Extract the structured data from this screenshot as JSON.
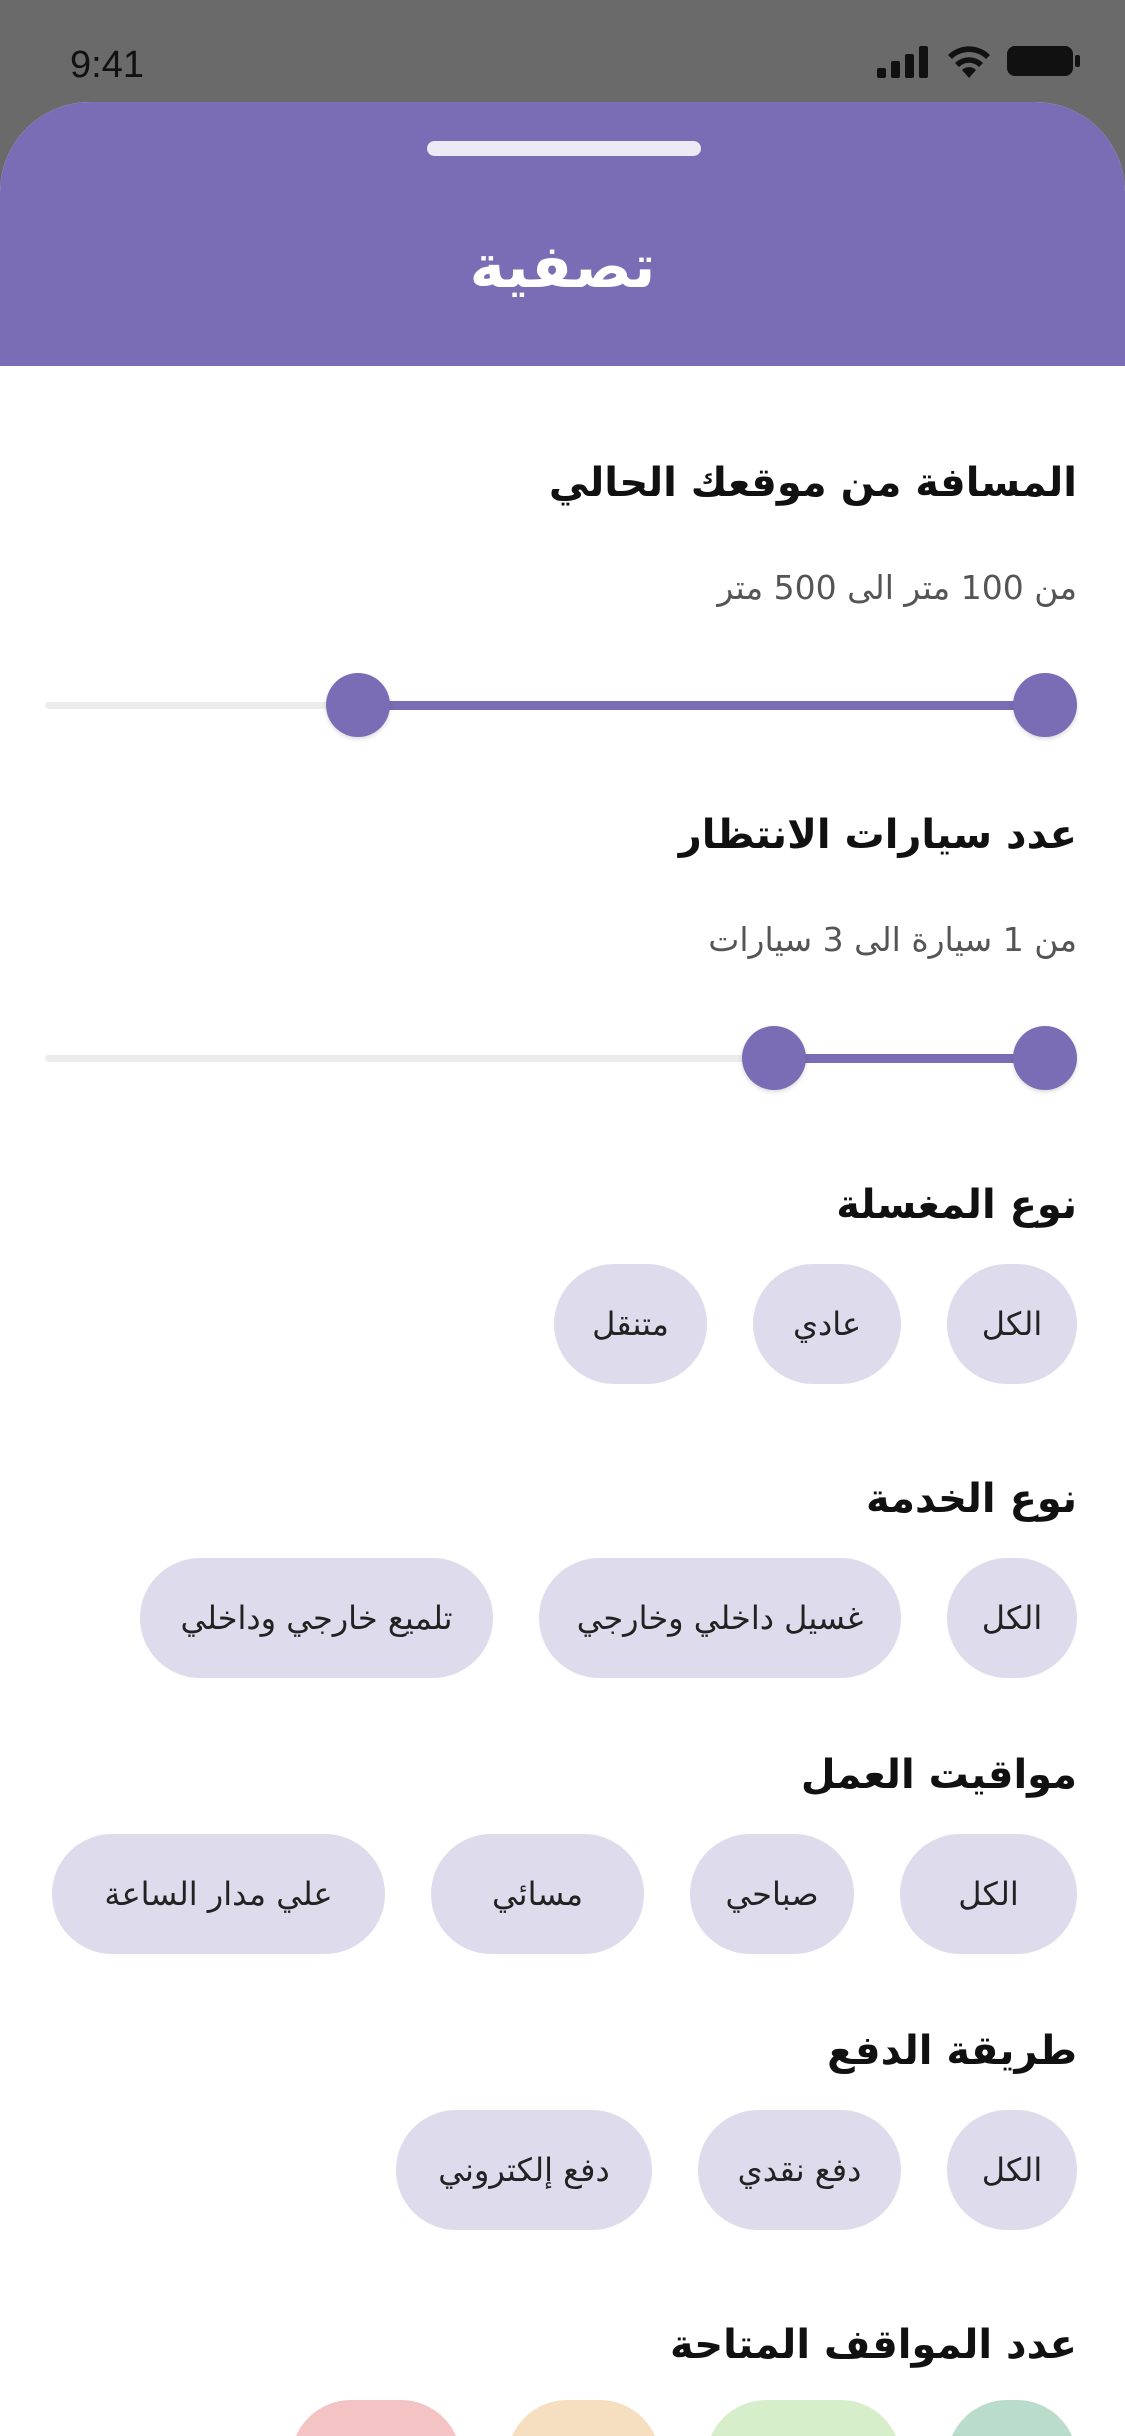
{
  "status_bar": {
    "time": "9:41"
  },
  "header": {
    "title": "تصفية",
    "accent_color": "#7b6db5"
  },
  "distance": {
    "title": "المسافة من موقعك الحالي",
    "range_text": "من 100 متر الى 500 متر",
    "slider": {
      "min_fraction": 0.29,
      "max_fraction": 1.0
    }
  },
  "queue": {
    "title": "عدد سيارات الانتظار",
    "range_text": "من 1 سيارة الى 3  سيارات",
    "slider": {
      "min_fraction": 0.72,
      "max_fraction": 1.0
    }
  },
  "wash_type": {
    "title": "نوع المغسلة",
    "options": [
      "الكل",
      "عادي",
      "متنقل"
    ]
  },
  "service_type": {
    "title": "نوع الخدمة",
    "options": [
      "الكل",
      "غسيل داخلي وخارجي",
      "تلميع خارجي وداخلي"
    ]
  },
  "working_hours": {
    "title": "مواقيت العمل",
    "options": [
      "الكل",
      "صباحي",
      "مسائي",
      "علي مدار الساعة"
    ]
  },
  "payment": {
    "title": "طريقة الدفع",
    "options": [
      "الكل",
      "دفع نقدي",
      "دفع إلكتروني"
    ]
  },
  "parking": {
    "title": "عدد المواقف المتاحة",
    "options_colors": [
      "#b9dccb",
      "#d6eec9",
      "#f6dfc0",
      "#f4c3c3"
    ]
  }
}
